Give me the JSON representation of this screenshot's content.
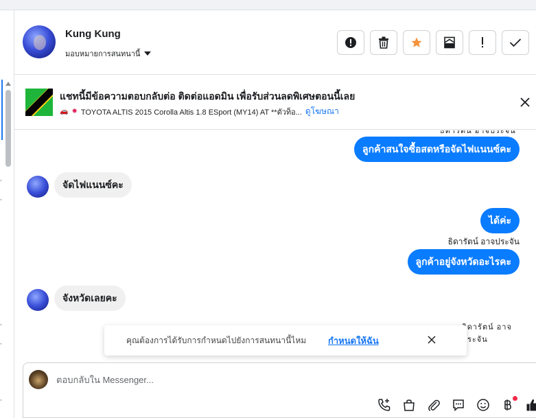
{
  "contact": {
    "name": "Kung Kung",
    "assign_label": "มอบหมายการสนทนานี้"
  },
  "header_actions": [
    {
      "icon": "alert-circle-icon"
    },
    {
      "icon": "trash-icon"
    },
    {
      "icon": "star-icon",
      "color": "#f5923e"
    },
    {
      "icon": "archive-icon"
    },
    {
      "icon": "exclamation-icon"
    },
    {
      "icon": "check-icon"
    }
  ],
  "ad_banner": {
    "title": "แชทนี้มีข้อความตอบกลับต่อ ติดต่อแอดมิน เพื่อรับส่วนลดพิเศษตอนนี้เลย",
    "subtitle": "TOYOTA ALTIS 2015 Corolla Altis 1.8 ESport (MY14) AT **ตัวท็อ...",
    "link": "ดูโฆษณา"
  },
  "messages": [
    {
      "direction": "out",
      "text": "ลูกค้าสนใจซื้อสดหรือจัดไฟแนนซ์คะ"
    },
    {
      "direction": "in",
      "text": "จัดไฟแนนซ์คะ"
    },
    {
      "direction": "out",
      "text": "ได้ค่ะ"
    },
    {
      "direction": "out",
      "sender": "ธิดารัตน์ อาจประจัน",
      "text": "ลูกค้าอยู่จังหวัดอะไรคะ"
    },
    {
      "direction": "in",
      "text": "จังหวัดเลยคะ"
    }
  ],
  "toast": {
    "text": "คุณต้องการได้รับการกำหนดไปยังการสนทนานี้ไหม",
    "link": "กำหนดให้ฉัน"
  },
  "composer": {
    "placeholder": "ตอบกลับใน Messenger...",
    "tools": [
      "call-add-icon",
      "shopping-bag-icon",
      "attachment-icon",
      "speech-bubble-icon",
      "emoji-icon",
      "baht-icon",
      "thumbs-up-icon"
    ]
  },
  "colors": {
    "accent": "#1877f2",
    "outgoing_bubble": "#0a7cff",
    "incoming_bubble": "#f0f0f0",
    "star": "#f5923e",
    "notification_dot": "#f02849"
  }
}
